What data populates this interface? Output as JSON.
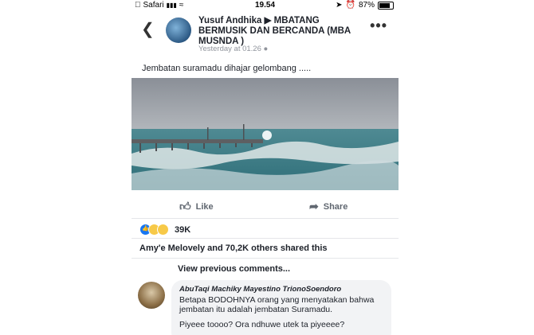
{
  "status_bar": {
    "carrier": "Safari",
    "time": "19.54",
    "battery_percent": "87%",
    "battery_level": 0.87
  },
  "post": {
    "author": "Yusuf Andhika ▶ MBATANG BERMUSIK DAN BERCANDA (MBA MUSNDA )",
    "time": "Yesterday at 01.26",
    "caption": "Jembatan suramadu dihajar gelombang .....",
    "like_label": "Like",
    "share_label": "Share",
    "reaction_count": "39K",
    "shared_text": "Amy'e Melovely and 70,2K others shared this",
    "view_previous": "View previous comments..."
  },
  "comment": {
    "author": "AbuTaqi Machiky Mayestino TrionoSoendoro",
    "text_1": "Betapa BODOHNYA orang yang menyatakan bahwa jembatan itu adalah jembatan Suramadu.",
    "text_2": "Piyeee toooo? Ora ndhuwe utek ta piyeeee?"
  },
  "icons": {
    "back": "chevron-left-icon",
    "more": "more-dots-icon",
    "like": "thumbs-up-icon",
    "share": "share-arrow-icon",
    "reactions": [
      "like-reaction-icon",
      "wow-reaction-icon",
      "sad-reaction-icon"
    ]
  },
  "colors": {
    "facebook_blue": "#1877f2",
    "text": "#1d2129",
    "muted": "#90949c"
  }
}
